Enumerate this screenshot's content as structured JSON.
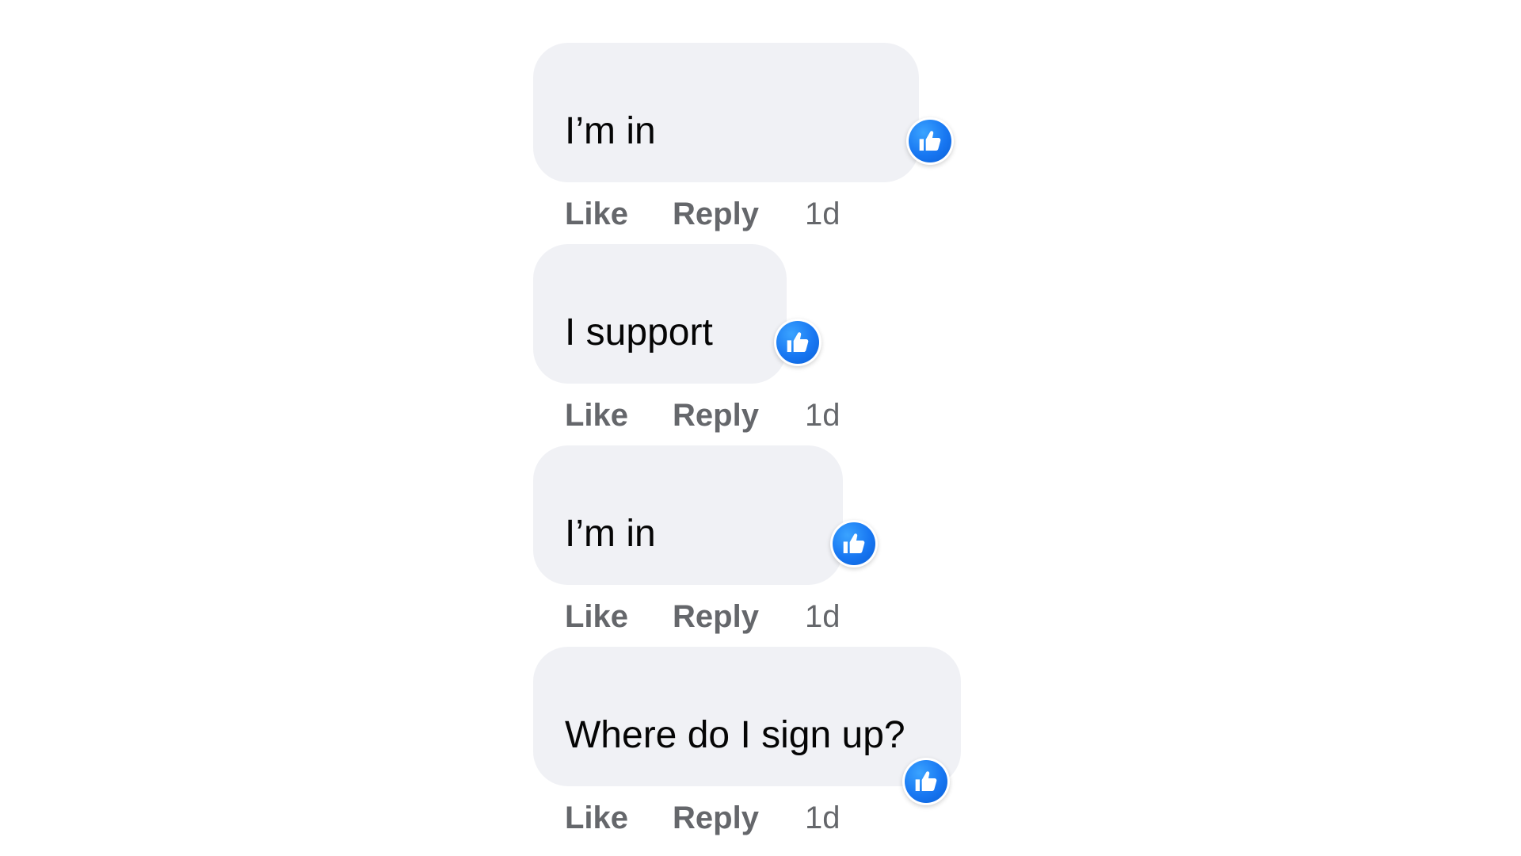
{
  "comments": [
    {
      "text": "I’m in",
      "like_label": "Like",
      "reply_label": "Reply",
      "time": "1d",
      "reaction_icon": "thumbs-up-icon"
    },
    {
      "text": "I support",
      "like_label": "Like",
      "reply_label": "Reply",
      "time": "1d",
      "reaction_icon": "thumbs-up-icon"
    },
    {
      "text": "I’m in",
      "like_label": "Like",
      "reply_label": "Reply",
      "time": "1d",
      "reaction_icon": "thumbs-up-icon"
    },
    {
      "text": "Where do I sign up?",
      "like_label": "Like",
      "reply_label": "Reply",
      "time": "1d",
      "reaction_icon": "thumbs-up-icon"
    }
  ],
  "colors": {
    "bubble_bg": "#f0f1f5",
    "text": "#050505",
    "action_text": "#65676b",
    "reaction_blue": "#1877f2"
  }
}
